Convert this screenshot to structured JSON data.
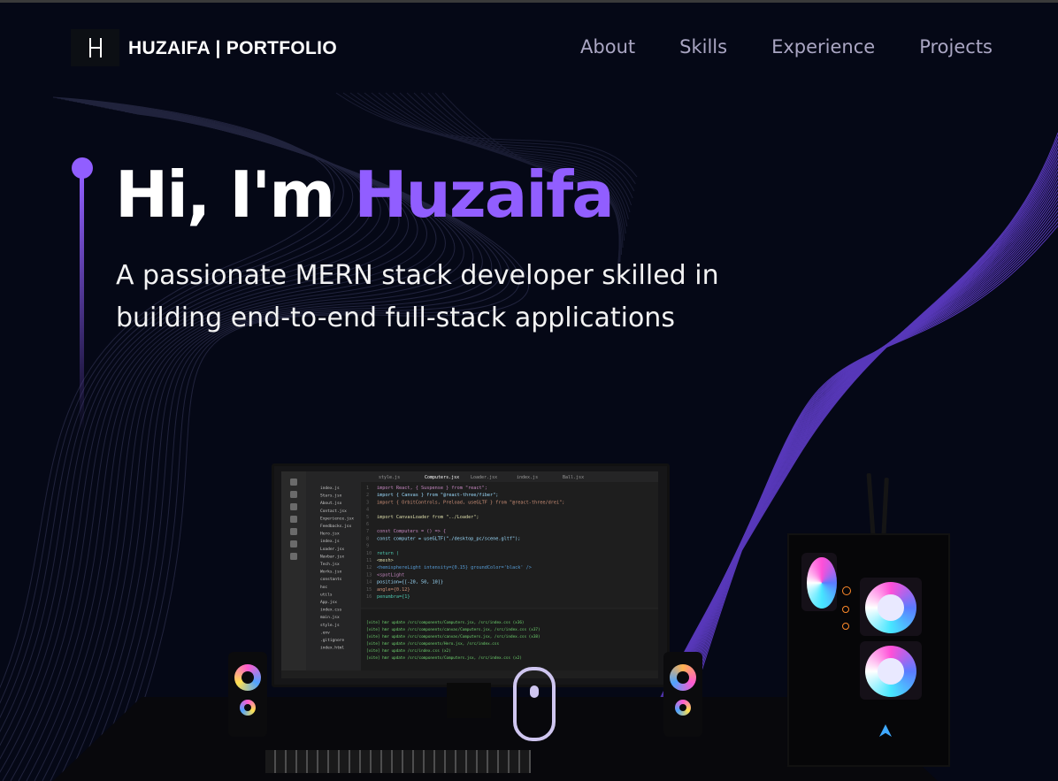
{
  "nav": {
    "brand": "HUZAIFA  | PORTFOLIO",
    "links": [
      "About",
      "Skills",
      "Experience",
      "Projects"
    ]
  },
  "hero": {
    "greeting": "Hi, I'm",
    "name": "Huzaifa",
    "subtitle_line1": "A passionate MERN stack developer skilled in",
    "subtitle_line2": "building end-to-end full-stack applications"
  },
  "colors": {
    "background": "#050816",
    "accent": "#915eff",
    "nav_link": "#aaa6c3"
  },
  "editor": {
    "tabs": [
      "style.js",
      "Computers.jsx",
      "Loader.jsx",
      "index.js",
      "Ball.jsx"
    ],
    "code_lines": [
      "import React, { Suspense } from \"react\";",
      "import { Canvas } from \"@react-three/fiber\";",
      "import { OrbitControls, Preload, useGLTF } from \"@react-three/drei\";",
      "",
      "import CanvasLoader from \"../Loader\";",
      "",
      "const Computers = () => {",
      "  const computer = useGLTF(\"./desktop_pc/scene.gltf\");",
      "",
      "  return (",
      "    <mesh>",
      "      <hemisphereLight intensity={0.15} groundColor='black' />",
      "      <spotLight",
      "        position={[-20, 50, 10]}",
      "        angle={0.12}",
      "        penumbra={1}"
    ],
    "files": [
      "index.js",
      "Stars.jsx",
      "About.jsx",
      "Contact.jsx",
      "Experience.jsx",
      "Feedbacks.jsx",
      "Hero.jsx",
      "index.js",
      "Loader.jsx",
      "Navbar.jsx",
      "Tech.jsx",
      "Works.jsx",
      "constants",
      "hoc",
      "utils",
      "App.jsx",
      "index.css",
      "main.jsx",
      "style.js",
      ".env",
      ".gitignore",
      "index.html"
    ],
    "terminal_lines": [
      "[vite] hmr update /src/components/Computers.jsx, /src/index.css (x36)",
      "[vite] hmr update /src/components/canvas/Computers.jsx, /src/index.css (x37)",
      "[vite] hmr update /src/components/canvas/Computers.jsx, /src/index.css (x38)",
      "[vite] hmr update /src/components/Hero.jsx, /src/index.css",
      "[vite] hmr update /src/index.css (x2)",
      "[vite] hmr update /src/components/Computers.jsx, /src/index.css (x2)"
    ]
  }
}
